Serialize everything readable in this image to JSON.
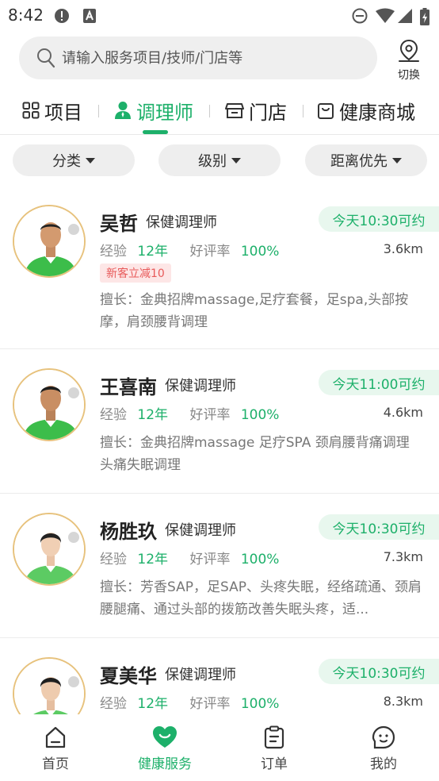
{
  "status_bar": {
    "time": "8:42"
  },
  "search": {
    "placeholder": "请输入服务项目/技师/门店等",
    "switch_label": "切换"
  },
  "tabs": [
    {
      "label": "项目",
      "icon": "grid-icon"
    },
    {
      "label": "调理师",
      "icon": "person-icon",
      "active": true
    },
    {
      "label": "门店",
      "icon": "store-icon"
    },
    {
      "label": "健康商城",
      "icon": "shopping-bag-icon"
    }
  ],
  "filters": [
    {
      "label": "分类"
    },
    {
      "label": "级别"
    },
    {
      "label": "距离优先"
    }
  ],
  "labels": {
    "experience": "经验",
    "rating": "好评率"
  },
  "therapists": [
    {
      "name": "吴哲",
      "title": "保健调理师",
      "availability": "今天10:30可约",
      "experience": "12年",
      "rating": "100%",
      "distance": "3.6km",
      "promo": "新客立减10",
      "skills": "擅长：金典招牌massage,足疗套餐，足spa,头部按摩，肩颈腰背调理",
      "gender": "male"
    },
    {
      "name": "王喜南",
      "title": "保健调理师",
      "availability": "今天11:00可约",
      "experience": "12年",
      "rating": "100%",
      "distance": "4.6km",
      "skills": "擅长：金典招牌massage 足疗SPA 颈肩腰背痛调理 头痛失眠调理",
      "gender": "male"
    },
    {
      "name": "杨胜玖",
      "title": "保健调理师",
      "availability": "今天10:30可约",
      "experience": "12年",
      "rating": "100%",
      "distance": "7.3km",
      "skills": "擅长：芳香SAP，足SAP、头疼失眠，经络疏通、颈肩腰腿痛、通过头部的拨筋改善失眠头疼，适...",
      "gender": "female"
    },
    {
      "name": "夏美华",
      "title": "保健调理师",
      "availability": "今天10:30可约",
      "experience": "12年",
      "rating": "100%",
      "distance": "8.3km",
      "gender": "female"
    }
  ],
  "bottom_nav": [
    {
      "label": "首页",
      "icon": "home-icon"
    },
    {
      "label": "健康服务",
      "icon": "heart-icon",
      "active": true
    },
    {
      "label": "订单",
      "icon": "clipboard-icon"
    },
    {
      "label": "我的",
      "icon": "smiley-icon"
    }
  ],
  "colors": {
    "accent": "#1db06a",
    "promo": "#e85a5a",
    "avatar_border": "#e7c27d"
  }
}
